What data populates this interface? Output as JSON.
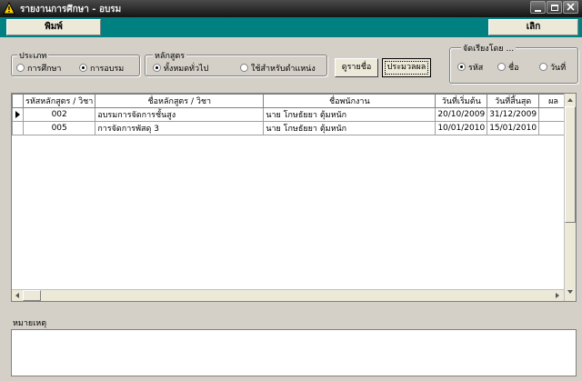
{
  "window": {
    "title": "รายงานการศึกษา - อบรม"
  },
  "toolbar": {
    "print_label": "พิมพ์",
    "cancel_label": "เลิก"
  },
  "type_group": {
    "legend": "ประเภท",
    "options": [
      {
        "label": "การศึกษา",
        "selected": false
      },
      {
        "label": "การอบรม",
        "selected": true
      }
    ]
  },
  "course_group": {
    "legend": "หลักสูตร",
    "options": [
      {
        "label": "ทั้งหมดทั่วไป",
        "selected": true
      },
      {
        "label": "ใช้สำหรับตำแหน่ง",
        "selected": false
      }
    ]
  },
  "buttons": {
    "view_names": "ดูรายชื่อ",
    "process": "ประมวลผล"
  },
  "sort_group": {
    "legend": "จัดเรียงโดย ...",
    "options": [
      {
        "label": "รหัส",
        "selected": true
      },
      {
        "label": "ชื่อ",
        "selected": false
      },
      {
        "label": "วันที่",
        "selected": false
      }
    ]
  },
  "table": {
    "headers": [
      "รหัสหลักสูตร / วิชา",
      "ชื่อหลักสูตร / วิชา",
      "ชื่อพนักงาน",
      "วันที่เริ่มต้น",
      "วันที่สิ้นสุด",
      "ผล"
    ],
    "rows": [
      {
        "code": "002",
        "course": "อบรมการจัดการชั้นสูง",
        "employee": "นาย โกษธัยยา ตุ้มหนัก",
        "start": "20/10/2009",
        "end": "31/12/2009",
        "result": ""
      },
      {
        "code": "005",
        "course": "การจัดการพัสดุ 3",
        "employee": "นาย โกษธัยยา ตุ้มหนัก",
        "start": "10/01/2010",
        "end": "15/01/2010",
        "result": ""
      }
    ]
  },
  "notes": {
    "label": "หมายเหตุ",
    "value": ""
  },
  "colors": {
    "teal": "#008080",
    "titlebar": "#1a1a1a",
    "face": "#d4d0c8"
  }
}
